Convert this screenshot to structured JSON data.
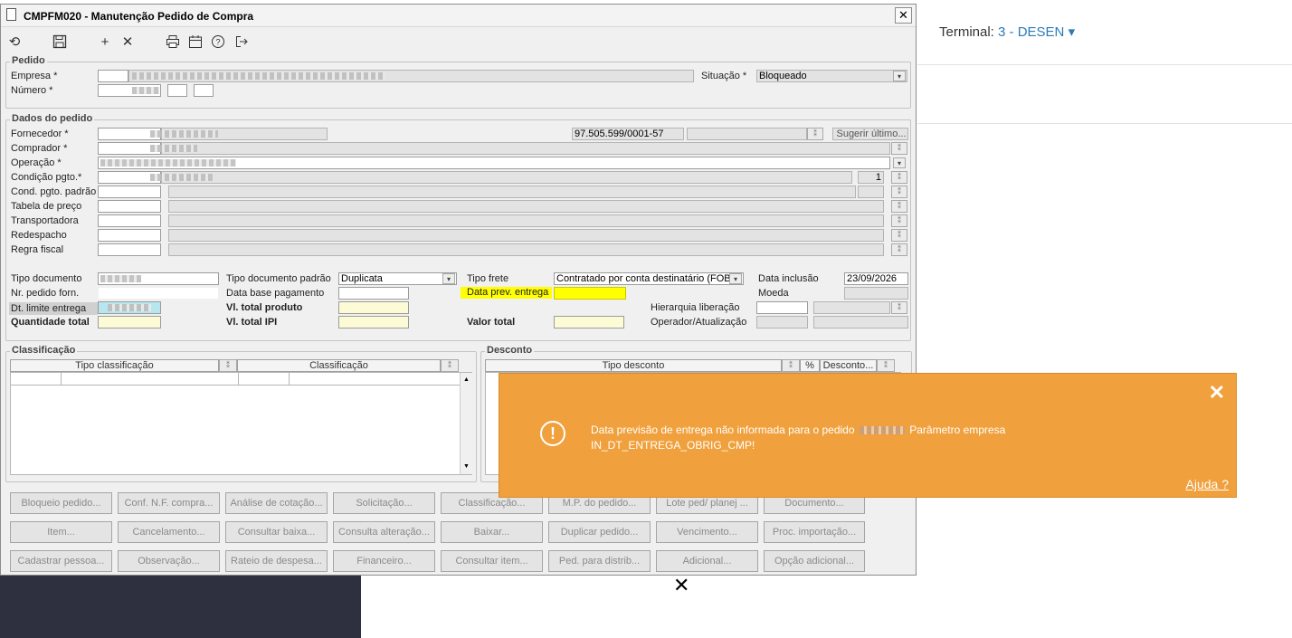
{
  "window": {
    "title": "CMPFM020 - Manutenção Pedido de Compra",
    "close_label": "✕"
  },
  "toolbar": {
    "icons": [
      "refresh-icon",
      "save-icon",
      "add-icon",
      "delete-icon",
      "print-icon",
      "calendar-icon",
      "help-icon",
      "exit-icon"
    ]
  },
  "terminal": {
    "label": "Terminal:",
    "value": "3 - DESEN",
    "caret": "▾"
  },
  "pedido": {
    "group_title": "Pedido",
    "empresa_label": "Empresa *",
    "numero_label": "Número *",
    "situacao_label": "Situação *",
    "situacao_value": "Bloqueado"
  },
  "dados": {
    "group_title": "Dados do pedido",
    "fornecedor_label": "Fornecedor *",
    "cnpj_value": "97.505.599/0001-57",
    "sugerir_label": "Sugerir último...",
    "comprador_label": "Comprador *",
    "operacao_label": "Operação *",
    "condicao_label": "Condição pgto.*",
    "condicao_num": "1",
    "cond_padrao_label": "Cond. pgto. padrão",
    "tabela_label": "Tabela de preço",
    "transportadora_label": "Transportadora",
    "redespacho_label": "Redespacho",
    "regra_label": "Regra fiscal",
    "tipo_doc_label": "Tipo documento",
    "tipo_doc_padrao_label": "Tipo documento padrão",
    "tipo_doc_padrao_value": "Duplicata",
    "tipo_frete_label": "Tipo frete",
    "tipo_frete_value": "Contratado por conta destinatário (FOB)",
    "data_inclusao_label": "Data inclusão",
    "data_inclusao_value": "23/09/2026",
    "nr_pedido_label": "Nr. pedido forn.",
    "data_base_label": "Data base pagamento",
    "data_prev_label": "Data prev. entrega",
    "moeda_label": "Moeda",
    "dt_limite_label": "Dt. limite entrega",
    "vl_produto_label": "Vl. total produto",
    "hierarquia_label": "Hierarquia liberação",
    "quantidade_label": "Quantidade total",
    "vl_ipi_label": "Vl. total IPI",
    "valor_total_label": "Valor total",
    "operador_label": "Operador/Atualização"
  },
  "classificacao": {
    "group_title": "Classificação",
    "col1": "Tipo classificação",
    "col2": "Classificação"
  },
  "desconto": {
    "group_title": "Desconto",
    "col1": "Tipo desconto",
    "col2": "%",
    "col3": "Desconto..."
  },
  "buttons": {
    "row1": [
      "Bloqueio pedido...",
      "Conf. N.F. compra...",
      "Análise de cotação...",
      "Solicitação...",
      "Classificação...",
      "M.P. do pedido...",
      "Lote ped/ planej ...",
      "Documento..."
    ],
    "row2": [
      "Item...",
      "Cancelamento...",
      "Consultar baixa...",
      "Consulta alteração...",
      "Baixar...",
      "Duplicar pedido...",
      "Vencimento...",
      "Proc. importação..."
    ],
    "row3": [
      "Cadastrar pessoa...",
      "Observação...",
      "Rateio de despesa...",
      "Financeiro...",
      "Consultar item...",
      "Ped. para distrib...",
      "Adicional...",
      "Opção adicional..."
    ]
  },
  "toast": {
    "close_label": "✕",
    "icon_label": "!",
    "message_part1": "Data previsão de entrega não informada para o pedido",
    "message_part2": "Parâmetro empresa",
    "message_line2": "IN_DT_ENTREGA_OBRIG_CMP!",
    "help_label": "Ajuda ?",
    "color": "#f0a03c"
  },
  "cursor": {
    "label": "✕"
  }
}
